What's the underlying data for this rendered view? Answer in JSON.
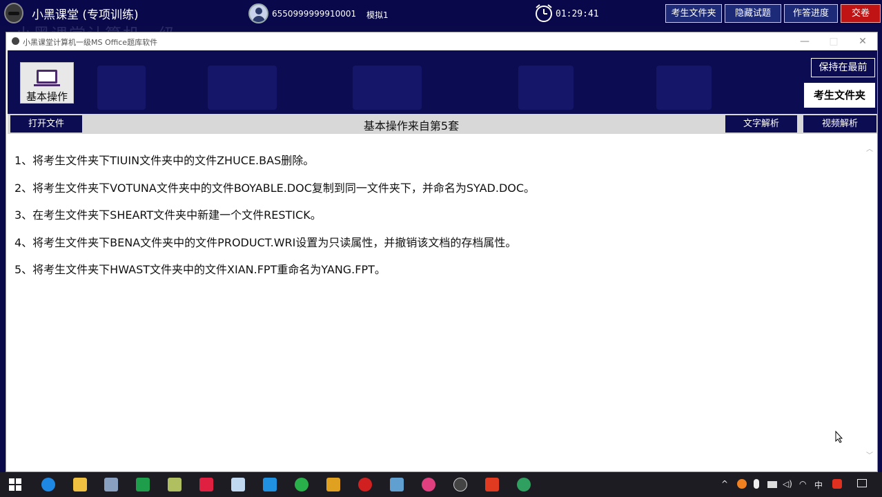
{
  "topbar": {
    "app_title": "小黑课堂 (专项训练)",
    "user_id": "6550999999910001",
    "mode": "模拟1",
    "timer": "01:29:41",
    "buttons": {
      "exam_folder": "考生文件夹",
      "hide_question": "隐藏试题",
      "progress": "作答进度",
      "submit": "交卷"
    },
    "colors": {
      "background": "#08084a",
      "submit": "#c01414"
    }
  },
  "background_text": "小黑课堂计算机一级",
  "window": {
    "title": "小黑课堂计算机一级MS Office题库软件",
    "controls": {
      "minimize": "—",
      "maximize": "□",
      "close": "✕"
    },
    "header": {
      "tool_label": "基本操作",
      "pin_label": "保持在最前",
      "exam_folder_label": "考生文件夹"
    },
    "toolbar": {
      "open_file": "打开文件",
      "title": "基本操作来自第5套",
      "text_analysis": "文字解析",
      "video_analysis": "视频解析"
    },
    "questions": [
      "1、将考生文件夹下TIUIN文件夹中的文件ZHUCE.BAS删除。",
      "2、将考生文件夹下VOTUNA文件夹中的文件BOYABLE.DOC复制到同一文件夹下，并命名为SYAD.DOC。",
      "3、在考生文件夹下SHEART文件夹中新建一个文件RESTICK。",
      "4、将考生文件夹下BENA文件夹中的文件PRODUCT.WRI设置为只读属性，并撤销该文档的存档属性。",
      "5、将考生文件夹下HWAST文件夹中的文件XIAN.FPT重命名为YANG.FPT。"
    ]
  },
  "taskbar": {
    "icons": [
      "windows-start",
      "edge",
      "file-explorer",
      "search-app",
      "excel-app",
      "notes-app",
      "xmind-app",
      "network-app",
      "star-app",
      "wechat",
      "colorful-app",
      "netease-music",
      "gallery-app",
      "chrome-like",
      "obs",
      "video-recorder",
      "edge-dev"
    ],
    "tray": {
      "input_method": "中"
    }
  }
}
